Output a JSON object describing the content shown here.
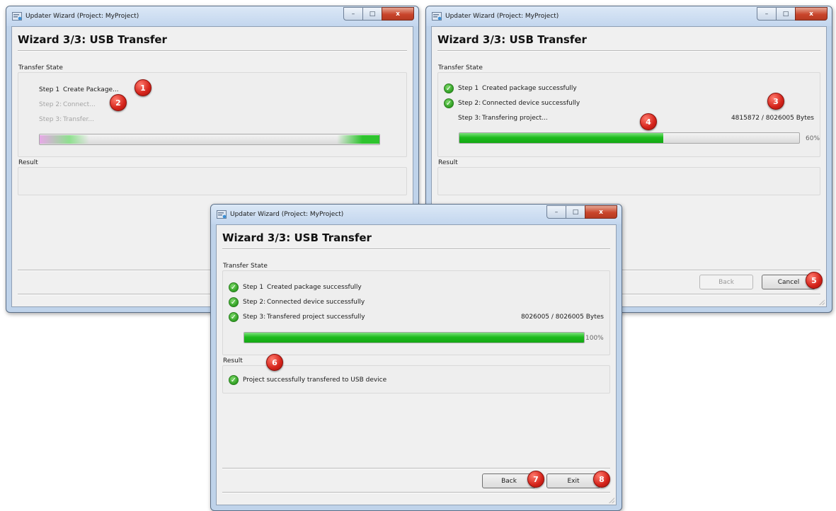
{
  "window": {
    "title": "Updater Wizard (Project: MyProject)",
    "heading": "Wizard 3/3:   USB Transfer",
    "minimize": "–",
    "maximize": "□",
    "close": "x"
  },
  "labels": {
    "transfer_state": "Transfer State",
    "result": "Result"
  },
  "screen1": {
    "steps": [
      {
        "num": "Step 1",
        "text": "Create Package..."
      },
      {
        "num": "Step 2:",
        "text": "Connect..."
      },
      {
        "num": "Step 3:",
        "text": "Transfer..."
      }
    ]
  },
  "screen2": {
    "steps": [
      {
        "num": "Step 1",
        "text": "Created package successfully"
      },
      {
        "num": "Step 2:",
        "text": "Connected device successfully"
      },
      {
        "num": "Step 3:",
        "text": "Transfering project..."
      }
    ],
    "bytes": "4815872 / 8026005 Bytes",
    "progress": 60,
    "progress_label": "60%",
    "back_label": "Back",
    "cancel_label": "Cancel"
  },
  "screen3": {
    "steps": [
      {
        "num": "Step 1",
        "text": "Created package successfully"
      },
      {
        "num": "Step 2:",
        "text": "Connected device successfully"
      },
      {
        "num": "Step 3:",
        "text": "Transfered project successfully"
      }
    ],
    "bytes": "8026005 / 8026005 Bytes",
    "progress": 100,
    "progress_label": "100%",
    "result_text": "Project successfully transfered to USB device",
    "back_label": "Back",
    "exit_label": "Exit"
  },
  "callouts": [
    "1",
    "2",
    "3",
    "4",
    "5",
    "6",
    "7",
    "8"
  ],
  "icons": {
    "app": "updater-app-icon",
    "success": "checkmark-icon"
  },
  "colors": {
    "progress_green": "#1dbb1d",
    "callout_red": "#d4231a",
    "success_green": "#2f9e22"
  }
}
